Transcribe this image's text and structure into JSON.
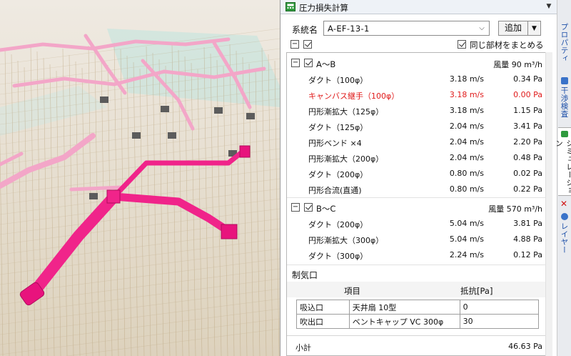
{
  "panel": {
    "title": "圧力損失計算",
    "system_label": "系統名",
    "system_value": "A-EF-13-1",
    "add_button": "追加",
    "merge_label": "同じ部材をまとめる"
  },
  "sections": [
    {
      "name": "A～B",
      "flow": "風量 90 m³/h",
      "rows": [
        {
          "name": "ダクト（100φ）",
          "velocity": "3.18 m/s",
          "pressure": "0.34 Pa",
          "highlight": false
        },
        {
          "name": "キャンバス継手（100φ）",
          "velocity": "3.18 m/s",
          "pressure": "0.00 Pa",
          "highlight": true
        },
        {
          "name": "円形漸拡大（125φ）",
          "velocity": "3.18 m/s",
          "pressure": "1.15 Pa",
          "highlight": false
        },
        {
          "name": "ダクト（125φ）",
          "velocity": "2.04 m/s",
          "pressure": "3.41 Pa",
          "highlight": false
        },
        {
          "name": "円形ベンド ×4",
          "velocity": "2.04 m/s",
          "pressure": "2.20 Pa",
          "highlight": false
        },
        {
          "name": "円形漸拡大（200φ）",
          "velocity": "2.04 m/s",
          "pressure": "0.48 Pa",
          "highlight": false
        },
        {
          "name": "ダクト（200φ）",
          "velocity": "0.80 m/s",
          "pressure": "0.02 Pa",
          "highlight": false
        },
        {
          "name": "円形合流(直通)",
          "velocity": "0.80 m/s",
          "pressure": "0.22 Pa",
          "highlight": false
        }
      ]
    },
    {
      "name": "B～C",
      "flow": "風量 570 m³/h",
      "rows": [
        {
          "name": "ダクト（200φ）",
          "velocity": "5.04 m/s",
          "pressure": "3.81 Pa",
          "highlight": false
        },
        {
          "name": "円形漸拡大（300φ）",
          "velocity": "5.04 m/s",
          "pressure": "4.88 Pa",
          "highlight": false
        },
        {
          "name": "ダクト（300φ）",
          "velocity": "2.24 m/s",
          "pressure": "0.12 Pa",
          "highlight": false
        }
      ]
    }
  ],
  "damper": {
    "label": "制気口",
    "col_item": "項目",
    "col_resistance": "抵抗[Pa]",
    "rows": [
      {
        "type": "吸込口",
        "model": "天井扇 10型",
        "value": "0"
      },
      {
        "type": "吹出口",
        "model": "ベントキャップ VC 300φ",
        "value": "30"
      }
    ]
  },
  "subtotal": {
    "label": "小計",
    "value": "46.63 Pa"
  },
  "side_tabs": [
    "プロパティ",
    "干渉検査",
    "シミュレーション",
    "レイヤー"
  ],
  "colors": {
    "duct_highlight": "#f0248a",
    "duct_pink": "#f3a6c8",
    "tab_text": "#1c4fa8",
    "error_red": "#e01a1a"
  }
}
